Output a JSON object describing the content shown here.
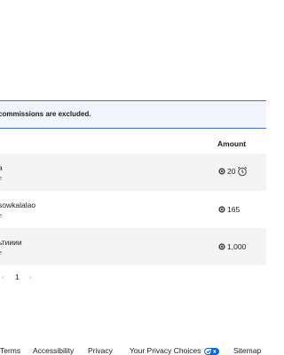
{
  "notice": {
    "text": "commissions are excluded."
  },
  "table": {
    "amount_header": "Amount",
    "rows": [
      {
        "name": "a",
        "sub": "e",
        "amount": "20",
        "has_clock": true
      },
      {
        "name": "sowkalalao",
        "sub": "e",
        "amount": "165",
        "has_clock": false
      },
      {
        "name": "ьтииии",
        "sub": "e",
        "amount": "1,000",
        "has_clock": false
      }
    ]
  },
  "pagination": {
    "prev": "‹",
    "current": "1",
    "next": "›"
  },
  "footer": {
    "terms": "Terms",
    "accessibility": "Accessibility",
    "privacy": "Privacy",
    "privacy_choices": "Your Privacy Choices",
    "sitemap": "Sitemap"
  },
  "colors": {
    "accent_border": "#4a6ee0",
    "notice_bg": "#f2f5fc",
    "row_alt_bg": "#f4f4f4",
    "privacy_icon": "#0066ff"
  }
}
